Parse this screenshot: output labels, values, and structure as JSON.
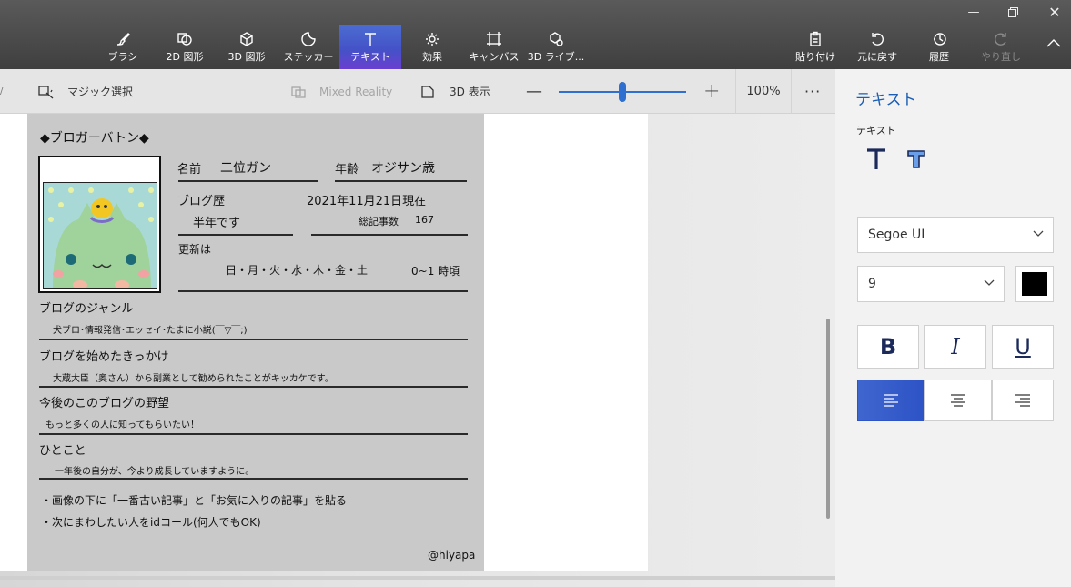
{
  "window": {
    "minimize_icon": "minimize-icon",
    "restore_icon": "restore-icon",
    "close_icon": "close-icon"
  },
  "ribbon": {
    "tools": [
      {
        "label": "ブラシ",
        "icon": "brush-icon"
      },
      {
        "label": "2D 図形",
        "icon": "2d-shapes-icon"
      },
      {
        "label": "3D 図形",
        "icon": "3d-shapes-icon"
      },
      {
        "label": "ステッカー",
        "icon": "sticker-icon"
      },
      {
        "label": "テキスト",
        "icon": "text-icon",
        "active": true
      },
      {
        "label": "効果",
        "icon": "effects-icon"
      },
      {
        "label": "キャンバス",
        "icon": "canvas-icon"
      },
      {
        "label": "3D ライブ...",
        "icon": "3d-library-icon"
      }
    ],
    "actions": [
      {
        "label": "貼り付け",
        "icon": "paste-icon"
      },
      {
        "label": "元に戻す",
        "icon": "undo-icon"
      },
      {
        "label": "履歴",
        "icon": "history-icon"
      },
      {
        "label": "やり直し",
        "icon": "redo-icon",
        "disabled": true
      }
    ]
  },
  "toolbar": {
    "magic_select": "マジック選択",
    "mixed_reality": "Mixed Reality",
    "view_3d": "3D 表示",
    "zoom_minus": "—",
    "zoom_plus": "+",
    "zoom_level": "100%",
    "zoom_fraction": 0.5,
    "more": "···"
  },
  "card": {
    "title": "◆ブロガーバトン◆",
    "name_label": "名前",
    "name_value": "二位ガン",
    "age_label": "年齢",
    "age_value": "オジサン歳",
    "blog_history_label": "ブログ歴",
    "as_of": "2021年11月21日現在",
    "blog_history_value": "半年です",
    "total_posts_label": "総記事数",
    "total_posts_value": "167",
    "update_label": "更新は",
    "update_days": "日・月・火・水・木・金・土",
    "update_time": "0~1 時頃",
    "genre_q": "ブログのジャンル",
    "genre_a": "犬ブロ･情報発信･エッセイ･たまに小説(￣▽￣;)",
    "reason_q": "ブログを始めたきっかけ",
    "reason_a": "大蔵大臣（奥さん）から副業として勧められたことがキッカケです。",
    "ambition_q": "今後のこのブログの野望",
    "ambition_a": "もっと多くの人に知ってもらいたい！",
    "comment_q": "ひとこと",
    "comment_a": "一年後の自分が、今より成長していますように。",
    "note1": "・画像の下に「一番古い記事」と「お気に入りの記事」を貼る",
    "note2": "・次にまわしたい人をidコール(何人でもOK)",
    "signature": "@hiyapa"
  },
  "panel": {
    "title": "テキスト",
    "subtitle": "テキスト",
    "font": "Segoe UI",
    "size": "9",
    "color": "#000000",
    "bold": "B",
    "italic": "I",
    "underline": "U"
  }
}
